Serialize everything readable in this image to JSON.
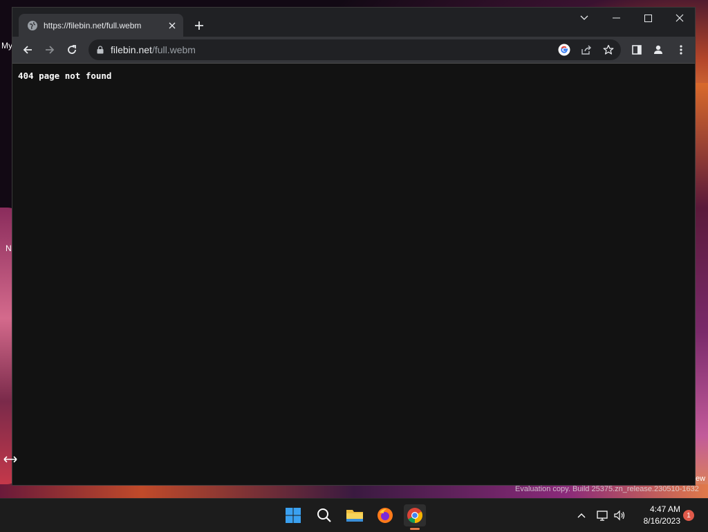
{
  "desktop": {
    "label_my": "My",
    "label_n": "N",
    "label_ew": "ew"
  },
  "browser": {
    "tab": {
      "title": "https://filebin.net/full.webm"
    },
    "address": {
      "host": "filebin.net",
      "path": "/full.webm"
    },
    "page": {
      "text": "404 page not found"
    }
  },
  "watermark": {
    "text": "Evaluation copy. Build 25375.zn_release.230510-1632"
  },
  "taskbar": {
    "clock": {
      "time": "4:47 AM",
      "date": "8/16/2023"
    },
    "notification_count": "1",
    "apps": [
      "windows-start",
      "search",
      "file-explorer",
      "firefox",
      "chrome"
    ]
  },
  "colors": {
    "titlebar": "#202124",
    "toolbar": "#35363a",
    "page_bg": "#121212",
    "taskbar": "#1c1c1c",
    "accent": "#e07a4a"
  }
}
